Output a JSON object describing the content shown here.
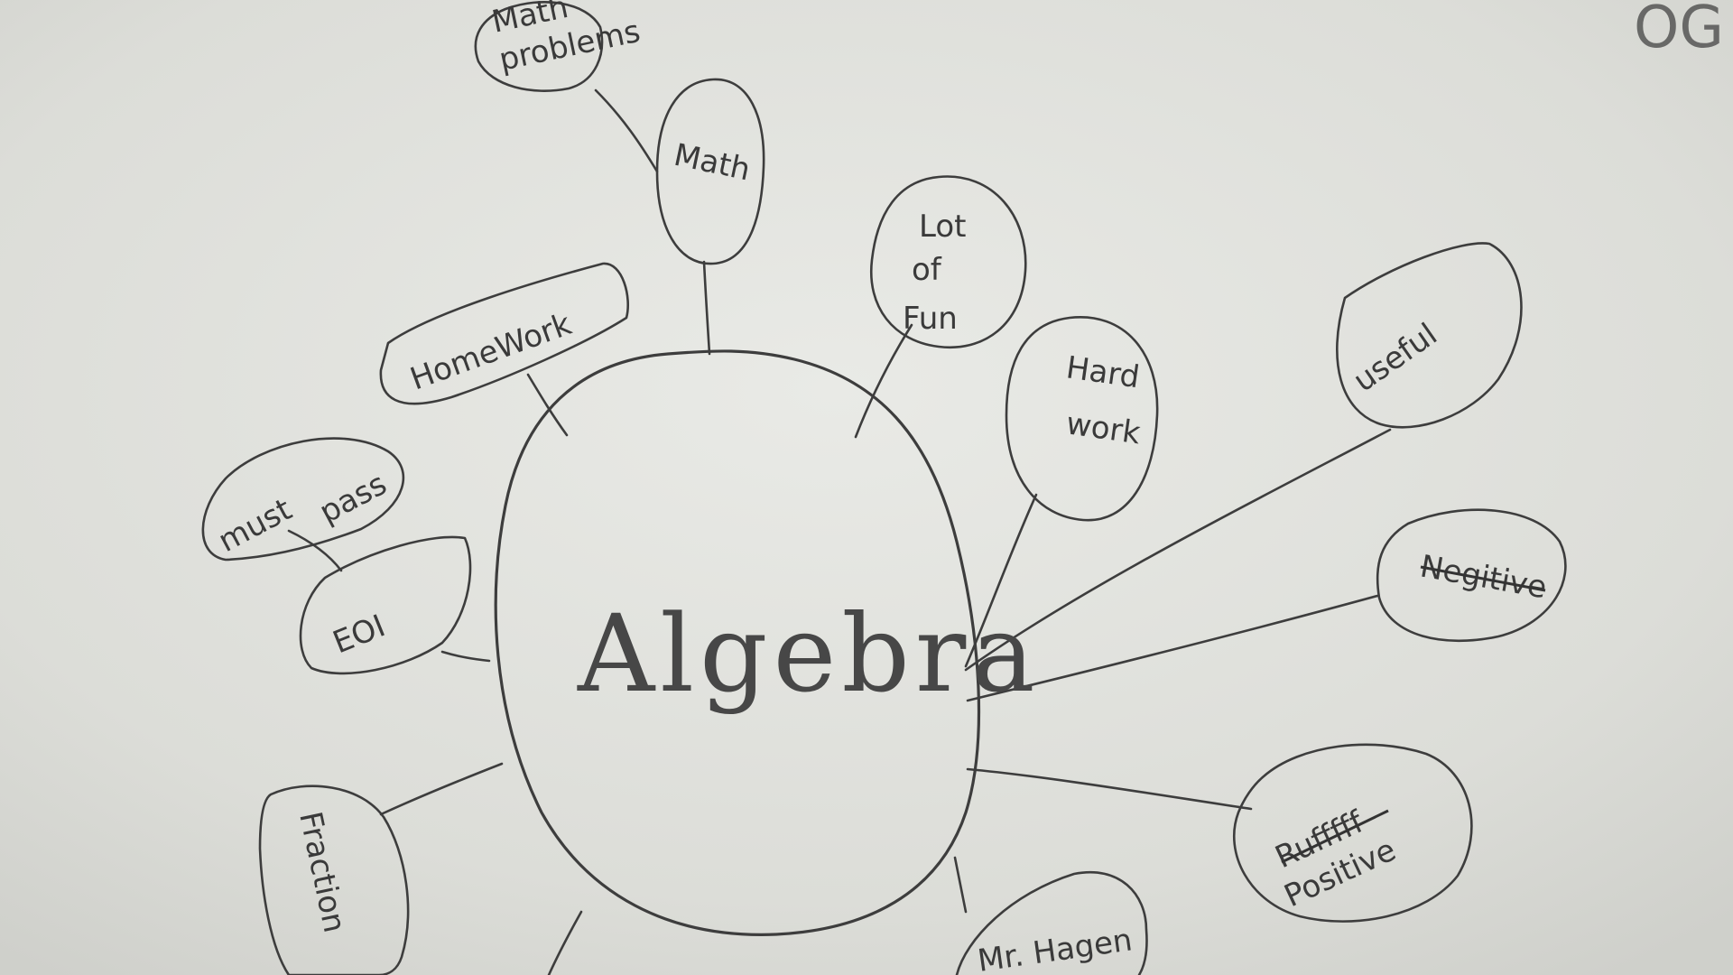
{
  "diagram": {
    "title": "",
    "center": {
      "label": "Algebra"
    },
    "nodes": [
      {
        "id": "math-problems",
        "lines": [
          "Math",
          "problems"
        ]
      },
      {
        "id": "math",
        "lines": [
          "Math"
        ]
      },
      {
        "id": "lot-of-fun",
        "lines": [
          "Lot",
          "of",
          "Fun"
        ]
      },
      {
        "id": "hard-work",
        "lines": [
          "Hard",
          "work"
        ]
      },
      {
        "id": "homework",
        "lines": [
          "HomeWork"
        ]
      },
      {
        "id": "must-pass",
        "lines": [
          "must",
          "pass"
        ]
      },
      {
        "id": "eoi",
        "lines": [
          "EOI"
        ]
      },
      {
        "id": "useful",
        "lines": [
          "useful"
        ]
      },
      {
        "id": "negitive",
        "lines": [
          "Negitive"
        ],
        "struck": "Negitive"
      },
      {
        "id": "positive",
        "lines": [
          "Positive"
        ],
        "struck": "Rufffff"
      },
      {
        "id": "fraction",
        "lines": [
          "Fraction"
        ]
      },
      {
        "id": "mr-hagen",
        "lines": [
          "Mr. Hagen"
        ]
      }
    ],
    "corner_mark": "OG"
  }
}
